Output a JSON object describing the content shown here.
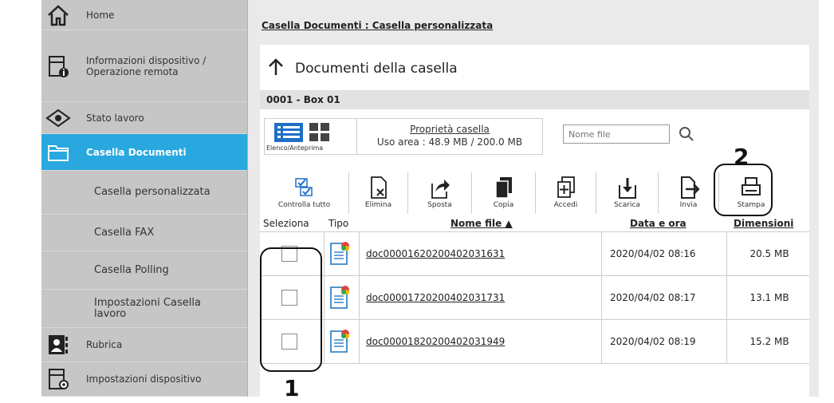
{
  "sidebar": {
    "items": [
      {
        "label": "Home",
        "icon": "home-icon"
      },
      {
        "label": "Informazioni dispositivo / Operazione remota",
        "icon": "device-info-icon"
      },
      {
        "label": "Stato lavoro",
        "icon": "eye-icon"
      },
      {
        "label": "Casella Documenti",
        "icon": "folder-icon",
        "active": true
      },
      {
        "label": "Casella personalizzata"
      },
      {
        "label": "Casella FAX"
      },
      {
        "label": "Casella Polling"
      },
      {
        "label": "Impostazioni Casella lavoro"
      },
      {
        "label": "Rubrica",
        "icon": "address-book-icon"
      },
      {
        "label": "Impostazioni dispositivo",
        "icon": "device-settings-icon"
      }
    ]
  },
  "breadcrumb": "Casella Documenti : Casella personalizzata",
  "panel": {
    "title": "Documenti della casella",
    "box_label": "0001 - Box 01",
    "view_label": "Elenco/Anteprima",
    "properties_link": "Proprietà casella",
    "usage": "Uso area : 48.9 MB / 200.0 MB",
    "search_placeholder": "Nome file"
  },
  "toolbar": [
    {
      "label": "Controlla tutto",
      "icon": "check-all-icon"
    },
    {
      "label": "Elimina",
      "icon": "delete-icon"
    },
    {
      "label": "Sposta",
      "icon": "move-icon"
    },
    {
      "label": "Copia",
      "icon": "copy-icon"
    },
    {
      "label": "Accedi",
      "icon": "join-icon"
    },
    {
      "label": "Scarica",
      "icon": "download-icon"
    },
    {
      "label": "Invia",
      "icon": "send-icon"
    },
    {
      "label": "Stampa",
      "icon": "print-icon"
    }
  ],
  "table": {
    "headers": {
      "select": "Seleziona",
      "type": "Tipo",
      "name": "Nome file ▲",
      "date": "Data e ora",
      "size": "Dimensioni"
    },
    "rows": [
      {
        "name": "doc00001620200402031631",
        "date": "2020/04/02 08:16",
        "size": "20.5 MB"
      },
      {
        "name": "doc00001720200402031731",
        "date": "2020/04/02 08:17",
        "size": "13.1 MB"
      },
      {
        "name": "doc00001820200402031949",
        "date": "2020/04/02 08:19",
        "size": "15.2 MB"
      }
    ]
  },
  "callouts": {
    "one": "1",
    "two": "2"
  },
  "colors": {
    "active": "#29a8df",
    "sidebar": "#c6c6c6",
    "content_bg": "#eaeaea"
  }
}
